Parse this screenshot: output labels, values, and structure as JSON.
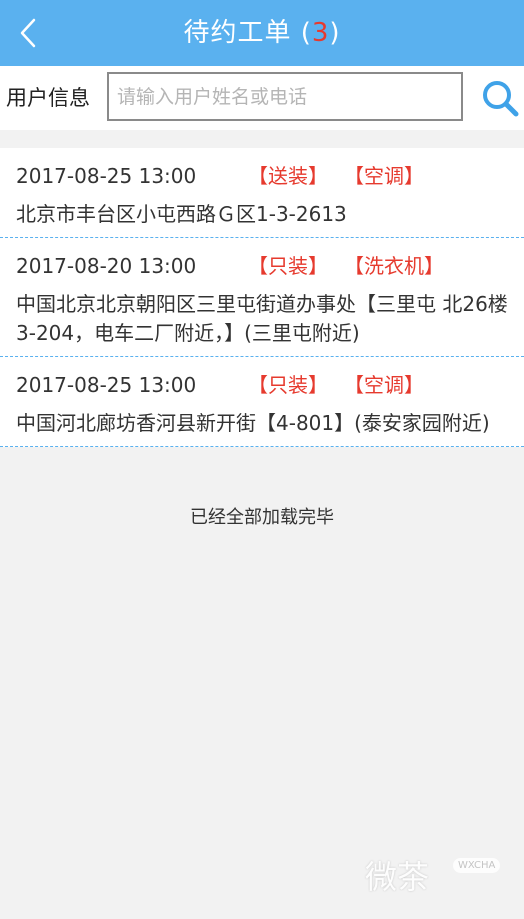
{
  "header": {
    "title_prefix": "待约工单 (",
    "count": "3",
    "title_suffix": ")",
    "back_icon": "chevron-left-icon"
  },
  "search": {
    "label": "用户信息",
    "placeholder": "请输入用户姓名或电话",
    "value": "",
    "button_icon": "search-icon"
  },
  "orders": [
    {
      "datetime": "2017-08-25 13:00",
      "tag_service": "【送装】",
      "tag_product": "【空调】",
      "address": "北京市丰台区小屯西路Ｇ区1-3-2613"
    },
    {
      "datetime": "2017-08-20 13:00",
      "tag_service": "【只装】",
      "tag_product": "【洗衣机】",
      "address": "中国北京北京朝阳区三里屯街道办事处【三里屯 北26楼3-204，电车二厂附近，】(三里屯附近)"
    },
    {
      "datetime": "2017-08-25 13:00",
      "tag_service": "【只装】",
      "tag_product": "【空调】",
      "address": "中国河北廊坊香河县新开街【4-801】(泰安家园附近)"
    }
  ],
  "footer": {
    "message": "已经全部加载完毕"
  },
  "watermark": {
    "text": "微茶",
    "badge": "WXCHA"
  },
  "colors": {
    "header_bg": "#5ab1ef",
    "accent_red": "#e63a2e",
    "divider": "#5ab1ef"
  }
}
